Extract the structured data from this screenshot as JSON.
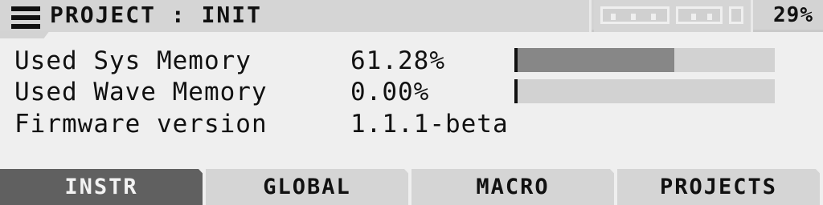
{
  "header": {
    "project_title": "PROJECT : INIT",
    "battery_percent": "29%",
    "menu_icon": "hamburger-menu-icon"
  },
  "info": {
    "rows": [
      {
        "label": "Used Sys Memory",
        "value": "61.28%",
        "meter_fraction": 0.6128
      },
      {
        "label": "Used Wave Memory",
        "value": "0.00%",
        "meter_fraction": 0.0
      },
      {
        "label": "Firmware version",
        "value": "1.1.1-beta"
      }
    ]
  },
  "tabs": [
    {
      "label": "INSTR",
      "active": true
    },
    {
      "label": "GLOBAL",
      "active": false
    },
    {
      "label": "MACRO",
      "active": false
    },
    {
      "label": "PROJECTS",
      "active": false
    }
  ],
  "colors": {
    "background": "#efefef",
    "panel": "#d5d5d5",
    "meter_track": "#d2d2d2",
    "meter_fill": "#878787",
    "active_tab": "#606060",
    "text": "#111111"
  }
}
